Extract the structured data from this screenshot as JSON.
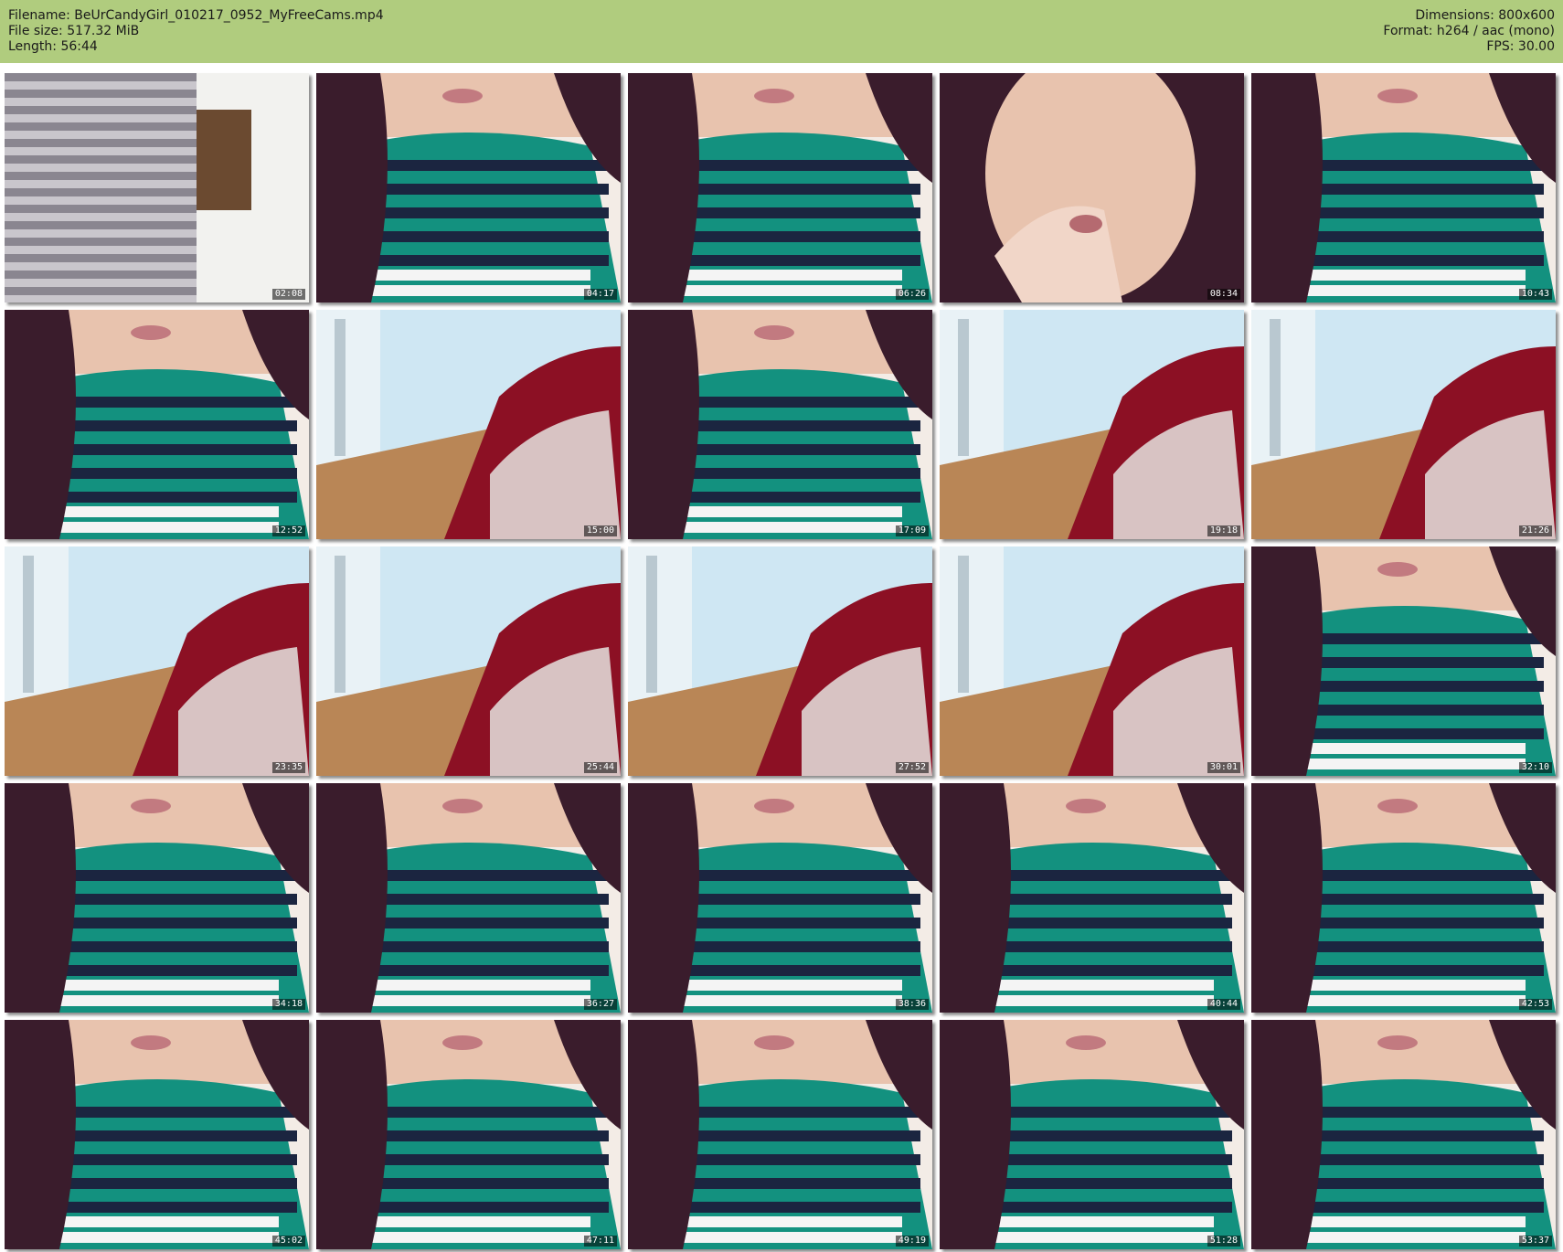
{
  "header": {
    "filename_line": "Filename: BeUrCandyGirl_010217_0952_MyFreeCams.mp4",
    "filesize_line": "File size: 517.32 MiB",
    "length_line": "Length: 56:44",
    "dimensions_line": "Dimensions: 800x600",
    "format_line": "Format: h264 / aac (mono)",
    "fps_line": "FPS: 30.00"
  },
  "colors": {
    "header_bg": "#b0cc7e",
    "shirt_teal": "#13917f",
    "shirt_stripe": "#1b2540",
    "hair": "#3a1c2c",
    "skin": "#e8c3ae",
    "wall": "#cfe7f3",
    "floor": "#b98656",
    "couch": "#8c1024",
    "blanket": "#d8c3c3"
  },
  "thumbnails": [
    {
      "time": "02:08",
      "scene": "blur"
    },
    {
      "time": "04:17",
      "scene": "closeup"
    },
    {
      "time": "06:26",
      "scene": "closeup"
    },
    {
      "time": "08:34",
      "scene": "face"
    },
    {
      "time": "10:43",
      "scene": "closeup"
    },
    {
      "time": "12:52",
      "scene": "closeup"
    },
    {
      "time": "15:00",
      "scene": "room"
    },
    {
      "time": "17:09",
      "scene": "closeup"
    },
    {
      "time": "19:18",
      "scene": "room"
    },
    {
      "time": "21:26",
      "scene": "room"
    },
    {
      "time": "23:35",
      "scene": "room"
    },
    {
      "time": "25:44",
      "scene": "room"
    },
    {
      "time": "27:52",
      "scene": "room"
    },
    {
      "time": "30:01",
      "scene": "room"
    },
    {
      "time": "32:10",
      "scene": "closeup"
    },
    {
      "time": "34:18",
      "scene": "closeup"
    },
    {
      "time": "36:27",
      "scene": "closeup"
    },
    {
      "time": "38:36",
      "scene": "closeup"
    },
    {
      "time": "40:44",
      "scene": "closeup"
    },
    {
      "time": "42:53",
      "scene": "closeup"
    },
    {
      "time": "45:02",
      "scene": "closeup"
    },
    {
      "time": "47:11",
      "scene": "closeup"
    },
    {
      "time": "49:19",
      "scene": "closeup"
    },
    {
      "time": "51:28",
      "scene": "closeup"
    },
    {
      "time": "53:37",
      "scene": "closeup"
    }
  ]
}
